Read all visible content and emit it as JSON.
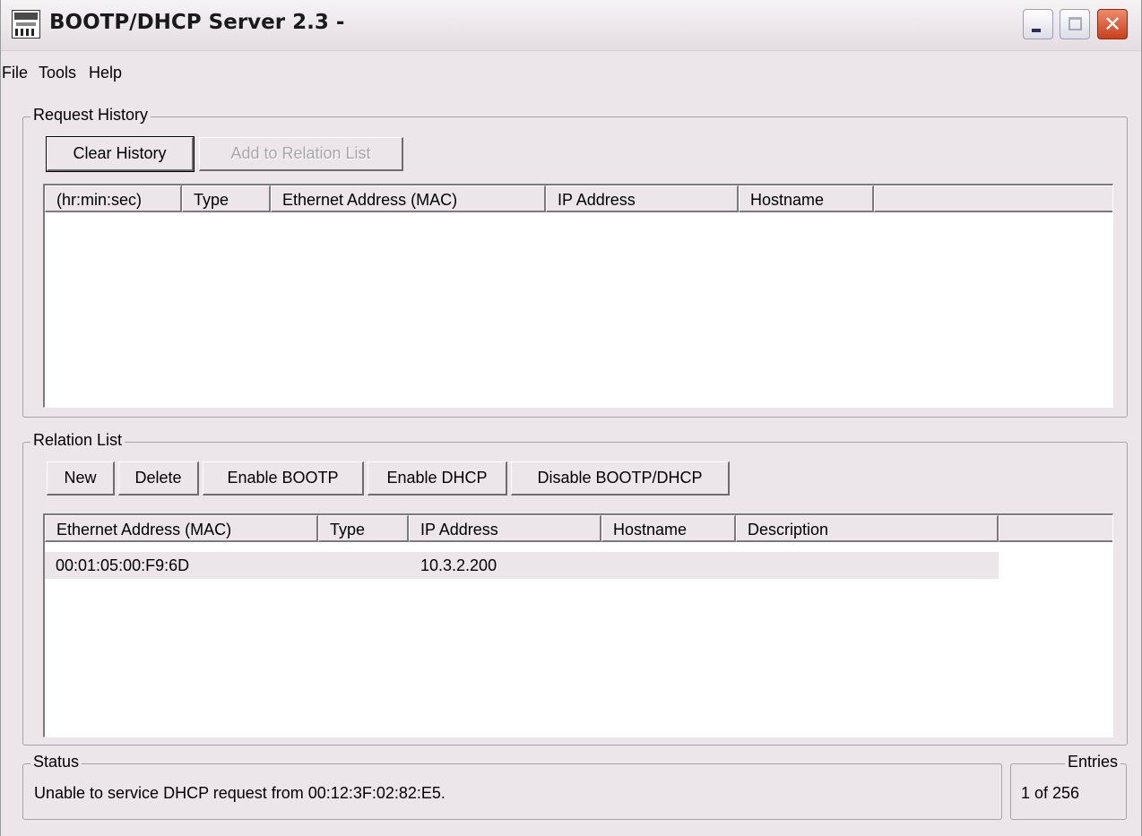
{
  "window": {
    "title": "BOOTP/DHCP Server 2.3 -",
    "close_glyph": "✕"
  },
  "menu": [
    "File",
    "Tools",
    "Help"
  ],
  "request_history": {
    "label": "Request History",
    "clear_button": "Clear History",
    "add_button": "Add to Relation List",
    "columns": [
      "(hr:min:sec)",
      "Type",
      "Ethernet Address (MAC)",
      "IP Address",
      "Hostname"
    ],
    "rows": []
  },
  "relation_list": {
    "label": "Relation List",
    "buttons": [
      "New",
      "Delete",
      "Enable BOOTP",
      "Enable DHCP",
      "Disable BOOTP/DHCP"
    ],
    "columns": [
      "Ethernet Address (MAC)",
      "Type",
      "IP Address",
      "Hostname",
      "Description"
    ],
    "rows": [
      {
        "mac": "00:01:05:00:F9:6D",
        "type": "",
        "ip": "10.3.2.200",
        "hostname": "",
        "description": ""
      }
    ]
  },
  "status": {
    "label": "Status",
    "message": "Unable to service DHCP request from 00:12:3F:02:82:E5."
  },
  "entries": {
    "label": "Entries",
    "value": "1 of 256"
  }
}
